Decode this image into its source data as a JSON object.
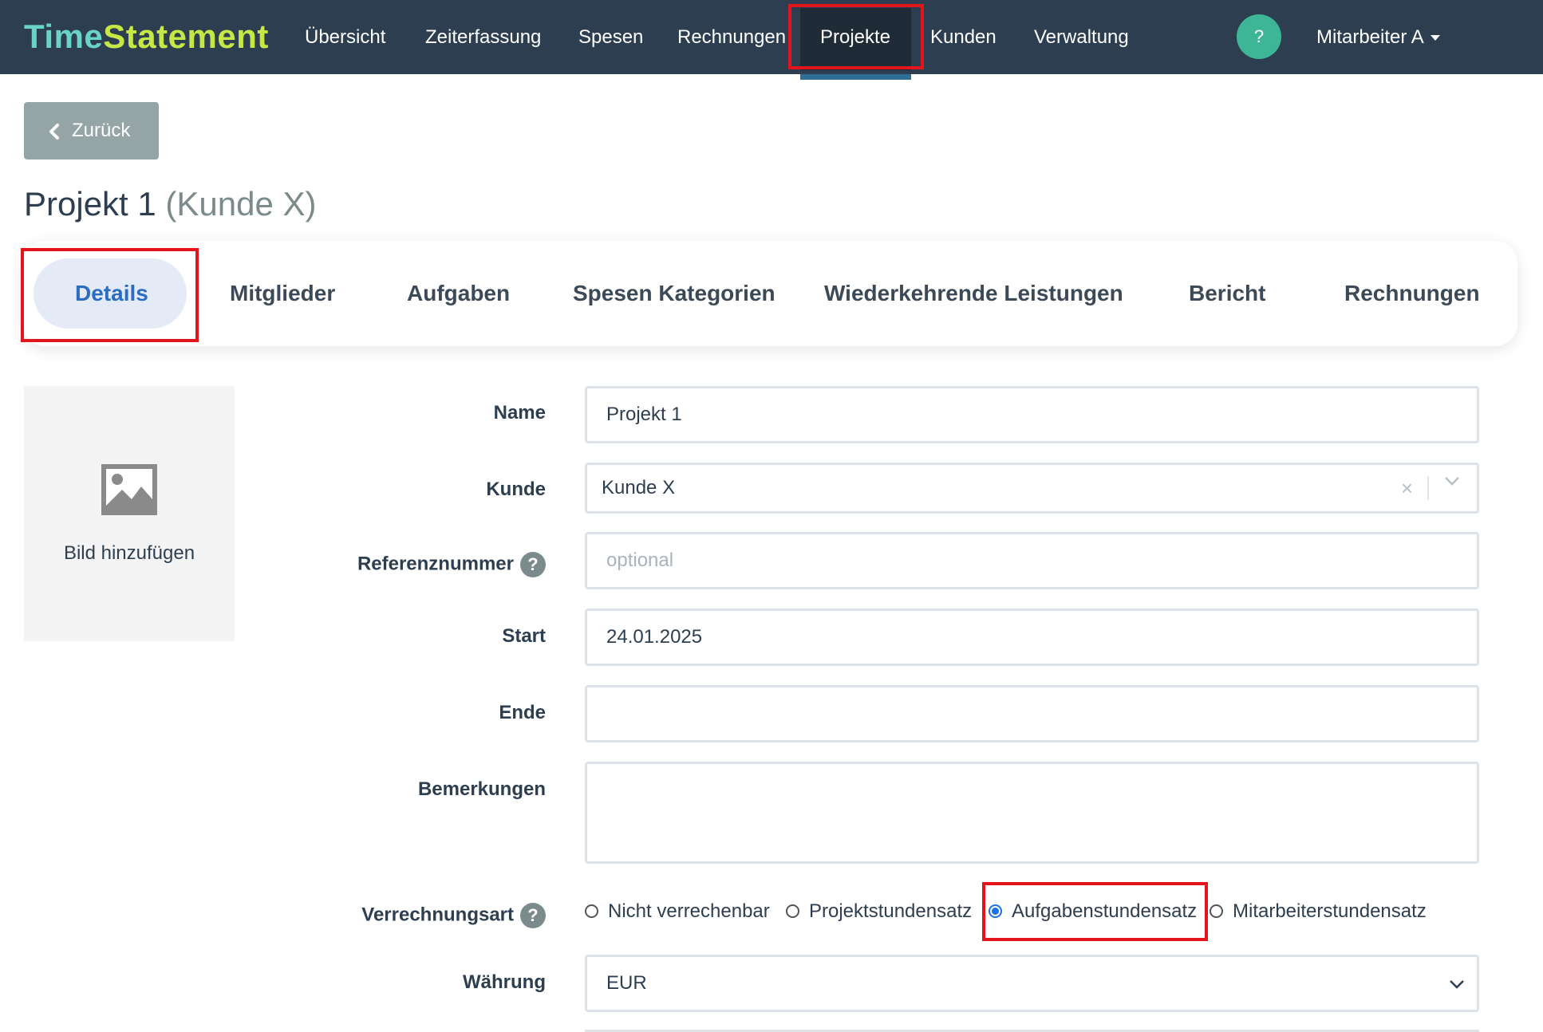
{
  "navbar": {
    "brand_part1": "Time",
    "brand_part2": "Statement",
    "links": [
      "Übersicht",
      "Zeiterfassung",
      "Spesen",
      "Rechnungen",
      "Projekte",
      "Kunden",
      "Verwaltung"
    ],
    "active_link": "Projekte",
    "help_label": "?",
    "user_label": "Mitarbeiter A"
  },
  "back_button": {
    "label": "Zurück"
  },
  "page": {
    "title": "Projekt 1",
    "subtitle": "(Kunde X)"
  },
  "tabs": [
    "Details",
    "Mitglieder",
    "Aufgaben",
    "Spesen Kategorien",
    "Wiederkehrende Leistungen",
    "Bericht",
    "Rechnungen"
  ],
  "active_tab": "Details",
  "image_box": {
    "label": "Bild hinzufügen"
  },
  "form": {
    "name": {
      "label": "Name",
      "value": "Projekt 1"
    },
    "kunde": {
      "label": "Kunde",
      "value": "Kunde X"
    },
    "referenznummer": {
      "label": "Referenznummer",
      "placeholder": "optional",
      "value": ""
    },
    "start": {
      "label": "Start",
      "value": "24.01.2025"
    },
    "ende": {
      "label": "Ende",
      "value": ""
    },
    "bemerkungen": {
      "label": "Bemerkungen",
      "value": ""
    },
    "verrechnungsart": {
      "label": "Verrechnungsart",
      "options": [
        "Nicht verrechenbar",
        "Projektstundensatz",
        "Aufgabenstundensatz",
        "Mitarbeiterstundensatz"
      ],
      "selected": "Aufgabenstundensatz"
    },
    "waehrung": {
      "label": "Währung",
      "value": "EUR"
    }
  },
  "colors": {
    "navbar_bg": "#2c3e50",
    "brand_time": "#6ad3c9",
    "brand_statement": "#c6e847",
    "help_circle": "#3eb596",
    "active_tab_text": "#2c6dc4",
    "highlight_red": "#e3141b"
  }
}
